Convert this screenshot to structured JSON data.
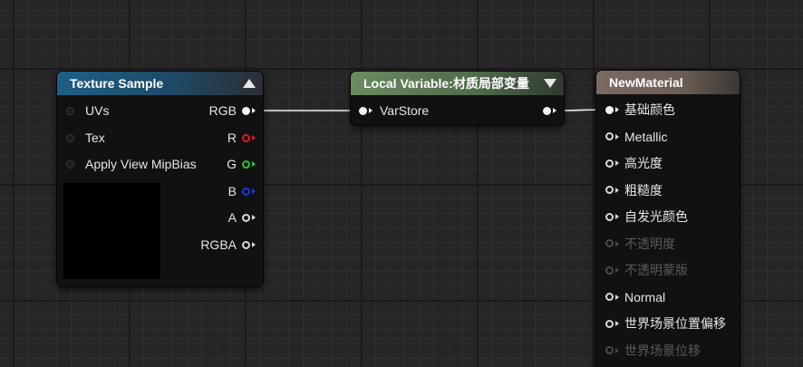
{
  "texture_node": {
    "title": "Texture Sample",
    "inputs": [
      "UVs",
      "Tex",
      "Apply View MipBias"
    ],
    "outputs": [
      "RGB",
      "R",
      "G",
      "B",
      "A",
      "RGBA"
    ],
    "colors": {
      "r": "#e01c1c",
      "g": "#26c53a",
      "b": "#2138e0"
    }
  },
  "variable_node": {
    "title": "Local Variable:材质局部变量",
    "input": "VarStore"
  },
  "material_node": {
    "title": "NewMaterial",
    "inputs": [
      {
        "label": "基础颜色",
        "state": "connected"
      },
      {
        "label": "Metallic",
        "state": "active"
      },
      {
        "label": "高光度",
        "state": "active"
      },
      {
        "label": "粗糙度",
        "state": "active"
      },
      {
        "label": "自发光颜色",
        "state": "active"
      },
      {
        "label": "不透明度",
        "state": "disabled"
      },
      {
        "label": "不透明蒙版",
        "state": "disabled"
      },
      {
        "label": "Normal",
        "state": "active"
      },
      {
        "label": "世界场景位置偏移",
        "state": "active"
      },
      {
        "label": "世界场景位移",
        "state": "disabled"
      }
    ]
  }
}
